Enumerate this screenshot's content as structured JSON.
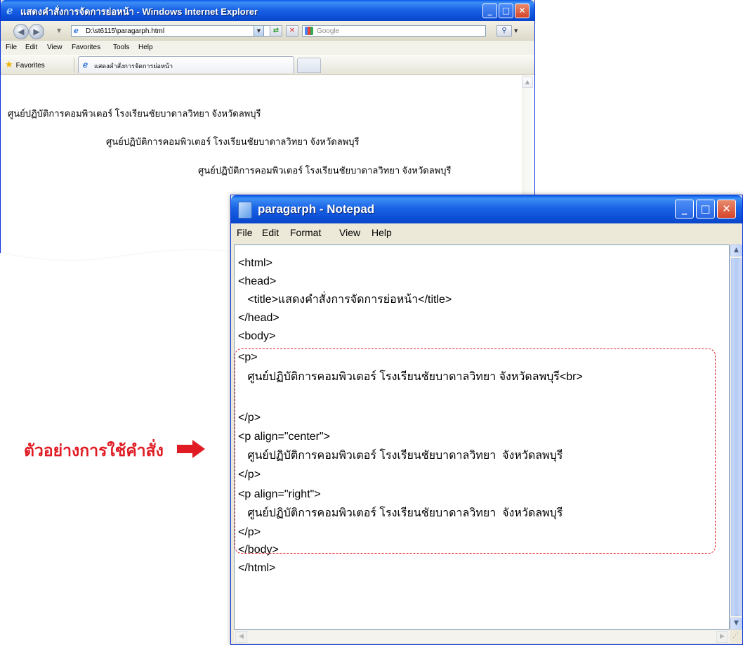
{
  "ie": {
    "title": "แสดงคำสั่งการจัดการย่อหน้า - Windows Internet Explorer",
    "address": "D:\\st6115\\paragarph.html",
    "search_placeholder": "Google",
    "menu": [
      "File",
      "Edit",
      "View",
      "Favorites",
      "Tools",
      "Help"
    ],
    "favorites_label": "Favorites",
    "tab_title": "แสดงคำสั่งการจัดการย่อหน้า",
    "content_lines": [
      "ศูนย์ปฏิบัติการคอมพิวเตอร์ โรงเรียนชัยบาดาลวิทยา จังหวัดลพบุรี",
      "ศูนย์ปฏิบัติการคอมพิวเตอร์ โรงเรียนชัยบาดาลวิทยา จังหวัดลพบุรี",
      "ศูนย์ปฏิบัติการคอมพิวเตอร์ โรงเรียนชัยบาดาลวิทยา จังหวัดลพบุรี"
    ]
  },
  "notepad": {
    "title": "paragarph - Notepad",
    "menu": [
      "File",
      "Edit",
      "Format",
      "View",
      "Help"
    ],
    "code_lines": [
      "<html>",
      "<head>",
      "   <title>แสดงคำสั่งการจัดการย่อหน้า</title>",
      "</head>",
      "<body>",
      "<p>",
      "   ศูนย์ปฏิบัติการคอมพิวเตอร์ โรงเรียนชัยบาดาลวิทยา จังหวัดลพบุรี<br>",
      "",
      "</p>",
      "<p align=\"center\">",
      "   ศูนย์ปฏิบัติการคอมพิวเตอร์ โรงเรียนชัยบาดาลวิทยา  จังหวัดลพบุรี",
      "</p>",
      "<p align=\"right\">",
      "   ศูนย์ปฏิบัติการคอมพิวเตอร์ โรงเรียนชัยบาดาลวิทยา  จังหวัดลพบุรี",
      "</p>",
      "</body>",
      "</html>"
    ]
  },
  "annotation": {
    "label": "ตัวอย่างการใช้คำสั่ง",
    "color": "#e01b24"
  },
  "colors": {
    "xp_titlebar": "#0a5be8",
    "xp_close": "#d5452a",
    "highlight": "#e5242b"
  }
}
